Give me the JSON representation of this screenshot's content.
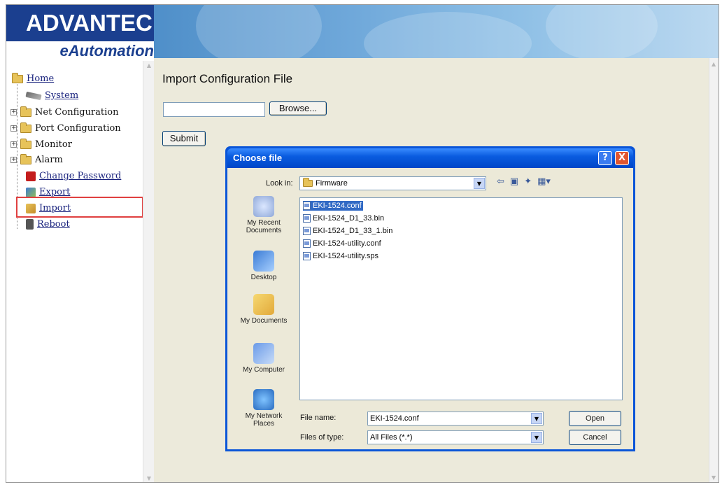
{
  "brand": {
    "name": "ADVANTECH",
    "tagline": "eAutomation"
  },
  "nav": {
    "home": "Home",
    "system": "System",
    "net_configuration": "Net Configuration",
    "port_configuration": "Port Configuration",
    "monitor": "Monitor",
    "alarm": "Alarm",
    "change_password": "Change Password",
    "export": "Export",
    "import": "Import",
    "reboot": "Reboot",
    "expand_symbol": "+"
  },
  "content": {
    "title": "Import Configuration File",
    "file_value": "",
    "browse_label": "Browse...",
    "submit_label": "Submit"
  },
  "dialog": {
    "title": "Choose file",
    "help_label": "?",
    "close_label": "X",
    "look_in_label": "Look in:",
    "look_in_value": "Firmware",
    "places": [
      "My Recent Documents",
      "Desktop",
      "My Documents",
      "My Computer",
      "My Network Places"
    ],
    "files": [
      "EKI-1524.conf",
      "EKI-1524_D1_33.bin",
      "EKI-1524_D1_33_1.bin",
      "EKI-1524-utility.conf",
      "EKI-1524-utility.sps"
    ],
    "selected_file_index": 0,
    "file_name_label": "File name:",
    "file_name_value": "EKI-1524.conf",
    "files_of_type_label": "Files of type:",
    "files_of_type_value": "All Files (*.*)",
    "open_label": "Open",
    "cancel_label": "Cancel"
  },
  "colors": {
    "brand_blue": "#1b3f8f",
    "content_bg": "#eceadb",
    "dialog_blue": "#0a55d8",
    "selection": "#316ac5",
    "highlight_box": "#e04040"
  }
}
